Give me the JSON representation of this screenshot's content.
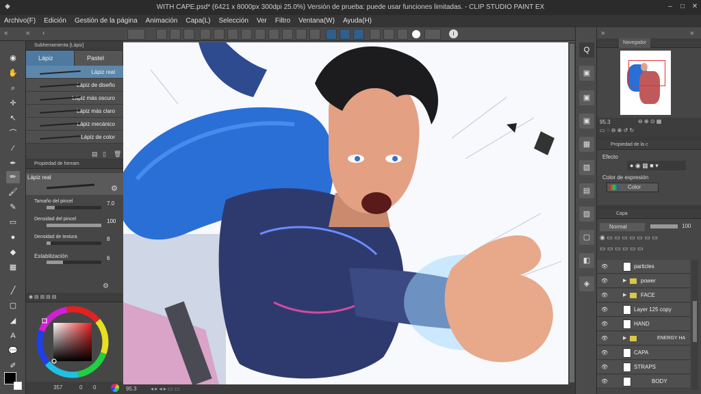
{
  "window": {
    "title": "WITH CAPE.psd* (6421 x 8000px 300dpi 25.0%)  Versión de prueba: puede usar funciones limitadas. - CLIP STUDIO PAINT EX"
  },
  "menu": [
    "Archivo(F)",
    "Edición",
    "Gestión de la página",
    "Animación",
    "Capa(L)",
    "Selección",
    "Ver",
    "Filtro",
    "Ventana(W)",
    "Ayuda(H)"
  ],
  "subtool": {
    "header": "Subherramienta [Lápiz]",
    "tabs": [
      "Lápiz",
      "Pastel"
    ],
    "brushes": [
      "Lápiz real",
      "Lápiz de diseño",
      "Lápiz más oscuro",
      "Lápiz más claro",
      "Lápiz mecánico",
      "Lápiz de color"
    ]
  },
  "toolprop": {
    "header": "Propiedad de herram",
    "preset": "Lápiz real",
    "props": [
      {
        "label": "Tamaño del pincel",
        "value": "7.0",
        "fill": 0.15
      },
      {
        "label": "Densidad del pincel",
        "value": "100",
        "fill": 1.0
      },
      {
        "label": "Densidad de textura",
        "value": "8",
        "fill": 0.08
      },
      {
        "label": "Estabilización",
        "value": "6",
        "fill": 0.3
      }
    ]
  },
  "color": {
    "main": "#000000",
    "sub": "#1a3a5a",
    "readout": "357",
    "readout2": "0",
    "readout3": "0"
  },
  "status": {
    "zoom": "95.3"
  },
  "navigator": {
    "tab": "Navegador",
    "zoom": "95.3"
  },
  "colorprop": {
    "tab": "Propiedad de la c",
    "effect_label": "Efecto",
    "expr_label": "Color de expresión",
    "expr_value": "Color"
  },
  "layers": {
    "tab": "Capa",
    "blend": "Normal",
    "opacity": "100",
    "items": [
      {
        "name": "particles",
        "type": "layer"
      },
      {
        "name": "power",
        "type": "folder"
      },
      {
        "name": "FACE",
        "type": "folder"
      },
      {
        "name": "Layer 125 copy",
        "type": "layer"
      },
      {
        "name": "HAND",
        "type": "layer"
      },
      {
        "name": "ENERGY HA",
        "type": "folder"
      },
      {
        "name": "CAPA",
        "type": "layer"
      },
      {
        "name": "STRAPS",
        "type": "layer"
      },
      {
        "name": "BODY",
        "type": "layer"
      }
    ]
  },
  "colors": {
    "accent": "#4e7aa0",
    "cape": "#2a6fd6",
    "skin": "#e8a88a"
  }
}
